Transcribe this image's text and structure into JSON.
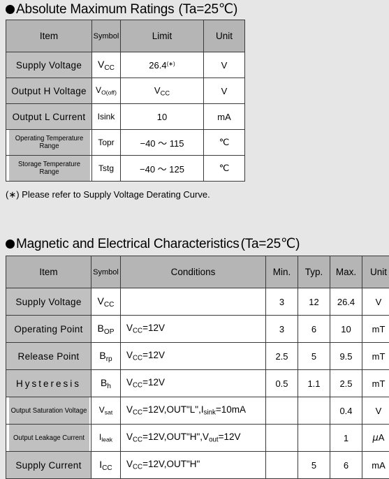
{
  "sections": [
    {
      "heading_bullet": "filled-circle",
      "heading_main": "Absolute Maximum Ratings",
      "heading_cond": "(Ta=25℃)",
      "columns": [
        "Item",
        "Symbol",
        "Limit",
        "Unit"
      ],
      "rows": [
        {
          "item": "Supply  Voltage",
          "symbol_base": "V",
          "symbol_sub": "CC",
          "limit": "26.4",
          "limit_sup": "(∗)",
          "unit": "V"
        },
        {
          "item": "Output H Voltage",
          "symbol_base": "V",
          "symbol_sub": "O(off)",
          "limit_base": "V",
          "limit_sub": "CC",
          "unit": "V"
        },
        {
          "item": "Output L Current",
          "symbol_base": "Isink",
          "symbol_sub": "",
          "limit": "10",
          "unit": "mA"
        },
        {
          "item": "Operating  Temperature  Range",
          "symbol_base": "Topr",
          "symbol_sub": "",
          "limit": "−40 ～ 115",
          "unit": "℃"
        },
        {
          "item": "Storage Temperature Range",
          "symbol_base": "Tstg",
          "symbol_sub": "",
          "limit": "−40 ～ 125",
          "unit": "℃"
        }
      ],
      "note": "(∗) Please refer to Supply Voltage Derating Curve."
    },
    {
      "heading_bullet": "filled-circle",
      "heading_main": "Magnetic and Electrical Characteristics",
      "heading_cond": "(Ta=25℃)",
      "columns": [
        "Item",
        "Symbol",
        "Conditions",
        "Min.",
        "Typ.",
        "Max.",
        "Unit"
      ],
      "rows": [
        {
          "item": "Supply  Voltage",
          "symbol_base": "V",
          "symbol_sub": "CC",
          "cond_parts": [],
          "min": "3",
          "typ": "12",
          "max": "26.4",
          "unit": "V"
        },
        {
          "item": "Operating Point",
          "symbol_base": "B",
          "symbol_sub": "OP",
          "cond_parts": [
            {
              "t": "V"
            },
            {
              "s": "CC"
            },
            {
              "t": "=12V"
            }
          ],
          "min": "3",
          "typ": "6",
          "max": "10",
          "unit": "mT"
        },
        {
          "item": "Release  Point",
          "symbol_base": "B",
          "symbol_sub": "rp",
          "cond_parts": [
            {
              "t": "V"
            },
            {
              "s": "CC"
            },
            {
              "t": "=12V"
            }
          ],
          "min": "2.5",
          "typ": "5",
          "max": "9.5",
          "unit": "mT"
        },
        {
          "item": "Hysteresis",
          "symbol_base": "B",
          "symbol_sub": "h",
          "cond_parts": [
            {
              "t": "V"
            },
            {
              "s": "CC"
            },
            {
              "t": "=12V"
            }
          ],
          "min": "0.5",
          "typ": "1.1",
          "max": "2.5",
          "unit": "mT"
        },
        {
          "item": "Output Saturation Voltage",
          "symbol_base": "V",
          "symbol_sub": "sat",
          "cond_parts": [
            {
              "t": "V"
            },
            {
              "s": "CC"
            },
            {
              "t": "=12V,OUT\"L\",I"
            },
            {
              "s": "sink"
            },
            {
              "t": "=10mA"
            }
          ],
          "min": "",
          "typ": "",
          "max": "0.4",
          "unit": "V"
        },
        {
          "item": "Output Leakage Current",
          "symbol_base": "I",
          "symbol_sub": "leak",
          "cond_parts": [
            {
              "t": "V"
            },
            {
              "s": "CC"
            },
            {
              "t": "=12V,OUT\"H\",V"
            },
            {
              "s": "out"
            },
            {
              "t": "=12V"
            }
          ],
          "min": "",
          "typ": "",
          "max": "1",
          "unit": "μA"
        },
        {
          "item": "Supply  Current",
          "symbol_base": "I",
          "symbol_sub": "CC",
          "cond_parts": [
            {
              "t": "V"
            },
            {
              "s": "CC"
            },
            {
              "t": "=12V,OUT\"H\""
            }
          ],
          "min": "",
          "typ": "5",
          "max": "6",
          "unit": "mA"
        }
      ]
    }
  ],
  "colors": {
    "page_background": "#e6e6e6",
    "header_fill": "#b5b5b5",
    "item_fill": "#c0c0c0",
    "border": "#3a3a3a",
    "cell_fill": "#ffffff"
  }
}
